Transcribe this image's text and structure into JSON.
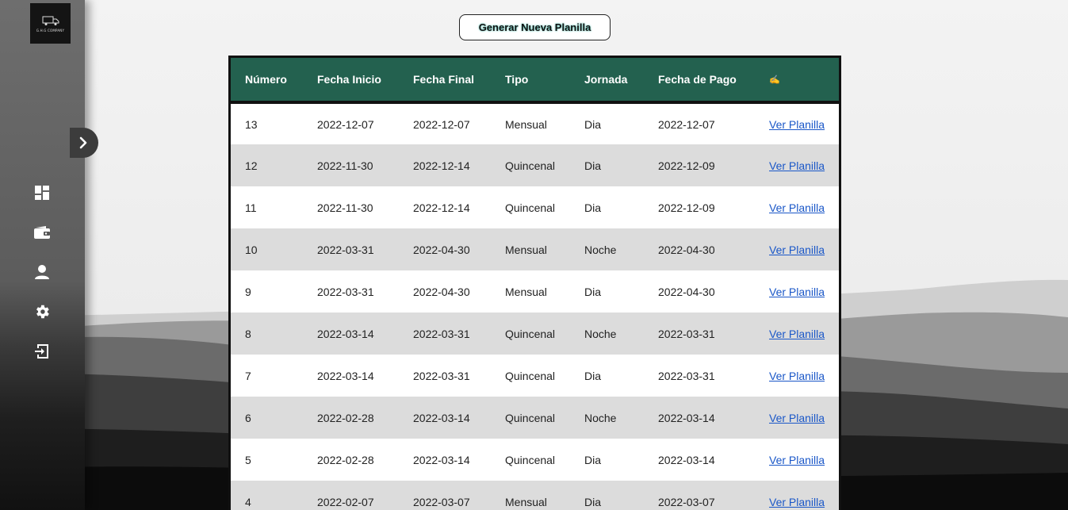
{
  "sidebar": {
    "logo_text": "G.H.G COMPANY",
    "toggle_icon": "chevron-right-icon",
    "nav_items": [
      {
        "icon": "dashboard-icon"
      },
      {
        "icon": "wallet-icon"
      },
      {
        "icon": "user-icon"
      },
      {
        "icon": "gear-icon"
      },
      {
        "icon": "logout-icon"
      }
    ]
  },
  "main": {
    "generate_button_label": "Generar Nueva Planilla",
    "table": {
      "headers": [
        "Número",
        "Fecha Inicio",
        "Fecha Final",
        "Tipo",
        "Jornada",
        "Fecha de Pago",
        "✍"
      ],
      "rows": [
        {
          "numero": "13",
          "fecha_inicio": "2022-12-07",
          "fecha_final": "2022-12-07",
          "tipo": "Mensual",
          "jornada": "Dia",
          "fecha_pago": "2022-12-07",
          "accion": "Ver Planilla"
        },
        {
          "numero": "12",
          "fecha_inicio": "2022-11-30",
          "fecha_final": "2022-12-14",
          "tipo": "Quincenal",
          "jornada": "Dia",
          "fecha_pago": "2022-12-09",
          "accion": "Ver Planilla"
        },
        {
          "numero": "11",
          "fecha_inicio": "2022-11-30",
          "fecha_final": "2022-12-14",
          "tipo": "Quincenal",
          "jornada": "Dia",
          "fecha_pago": "2022-12-09",
          "accion": "Ver Planilla"
        },
        {
          "numero": "10",
          "fecha_inicio": "2022-03-31",
          "fecha_final": "2022-04-30",
          "tipo": "Mensual",
          "jornada": "Noche",
          "fecha_pago": "2022-04-30",
          "accion": "Ver Planilla"
        },
        {
          "numero": "9",
          "fecha_inicio": "2022-03-31",
          "fecha_final": "2022-04-30",
          "tipo": "Mensual",
          "jornada": "Dia",
          "fecha_pago": "2022-04-30",
          "accion": "Ver Planilla"
        },
        {
          "numero": "8",
          "fecha_inicio": "2022-03-14",
          "fecha_final": "2022-03-31",
          "tipo": "Quincenal",
          "jornada": "Noche",
          "fecha_pago": "2022-03-31",
          "accion": "Ver Planilla"
        },
        {
          "numero": "7",
          "fecha_inicio": "2022-03-14",
          "fecha_final": "2022-03-31",
          "tipo": "Quincenal",
          "jornada": "Dia",
          "fecha_pago": "2022-03-31",
          "accion": "Ver Planilla"
        },
        {
          "numero": "6",
          "fecha_inicio": "2022-02-28",
          "fecha_final": "2022-03-14",
          "tipo": "Quincenal",
          "jornada": "Noche",
          "fecha_pago": "2022-03-14",
          "accion": "Ver Planilla"
        },
        {
          "numero": "5",
          "fecha_inicio": "2022-02-28",
          "fecha_final": "2022-03-14",
          "tipo": "Quincenal",
          "jornada": "Dia",
          "fecha_pago": "2022-03-14",
          "accion": "Ver Planilla"
        },
        {
          "numero": "4",
          "fecha_inicio": "2022-02-07",
          "fecha_final": "2022-03-07",
          "tipo": "Mensual",
          "jornada": "Dia",
          "fecha_pago": "2022-03-07",
          "accion": "Ver Planilla"
        }
      ]
    }
  },
  "colors": {
    "table_header": "#23614f",
    "link": "#1a57c8",
    "row_alt": "#dcdcdc"
  }
}
